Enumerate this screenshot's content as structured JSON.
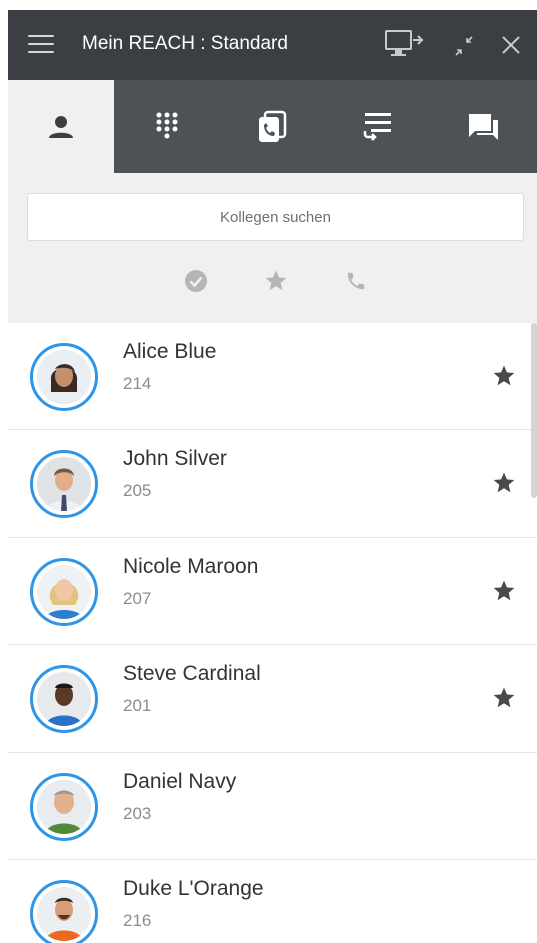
{
  "titlebar": {
    "title": "Mein REACH : Standard",
    "icons": [
      "menu-icon",
      "screen-share-icon",
      "minimize-icon",
      "close-icon"
    ],
    "background": "#3b3f43"
  },
  "tabs": [
    {
      "id": "contacts",
      "icon": "person-icon",
      "active": true
    },
    {
      "id": "dialpad",
      "icon": "dialpad-icon",
      "active": false
    },
    {
      "id": "call-log",
      "icon": "call-log-icon",
      "active": false
    },
    {
      "id": "queue",
      "icon": "queue-list-icon",
      "active": false
    },
    {
      "id": "chat",
      "icon": "chat-icon",
      "active": false
    }
  ],
  "search": {
    "placeholder": "Kollegen suchen",
    "value": ""
  },
  "filters": [
    "available-filter-icon",
    "favorites-filter-icon",
    "phone-filter-icon"
  ],
  "colors": {
    "accent": "#2f95e6",
    "tab_bar": "#4d5257",
    "panel_bg": "#f0f0f0"
  },
  "contacts": [
    {
      "name": "Alice Blue",
      "extension": "214",
      "favorite": true
    },
    {
      "name": "John Silver",
      "extension": "205",
      "favorite": true
    },
    {
      "name": "Nicole Maroon",
      "extension": "207",
      "favorite": true
    },
    {
      "name": "Steve Cardinal",
      "extension": "201",
      "favorite": true
    },
    {
      "name": "Daniel Navy",
      "extension": "203",
      "favorite": false
    },
    {
      "name": "Duke L'Orange",
      "extension": "216",
      "favorite": false
    }
  ]
}
